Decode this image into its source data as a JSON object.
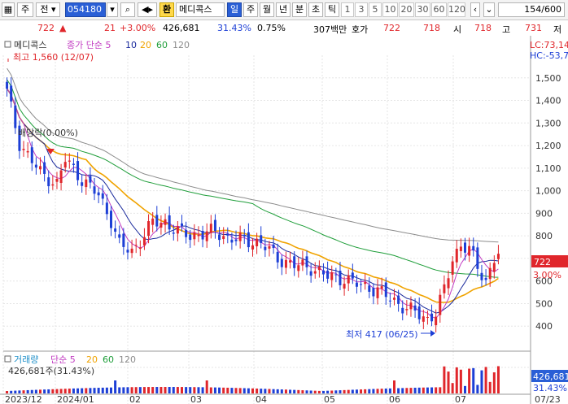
{
  "toolbar": {
    "type_label": "주",
    "period_label": "전",
    "stock_code": "054180",
    "exchange_label": "환",
    "stock_name": "메디콕스",
    "periods": [
      "일",
      "주",
      "월",
      "년",
      "분",
      "초",
      "틱"
    ],
    "selected_period": "일",
    "intervals": [
      "1",
      "3",
      "5",
      "10",
      "20",
      "30",
      "60",
      "120"
    ],
    "page_count": "154",
    "page_total": "/600"
  },
  "quote": {
    "price": "722",
    "change_arrow": "▲",
    "change": "21",
    "change_pct": "+3.00%",
    "volume": "426,681",
    "turnover_pct": "31.43%",
    "ratio": "0.75%",
    "amount": "307백만",
    "bid_label": "호가",
    "bid": "722",
    "ask": "718",
    "open_label": "시",
    "open": "718",
    "high_label": "고",
    "high": "731",
    "low_label": "저"
  },
  "chart": {
    "legend_name": "메디콕스",
    "legend_ma_label": "종가 단순 5",
    "legend_ma": [
      "10",
      "20",
      "60",
      "120"
    ],
    "high_note": "최고 1,560 (12/07)",
    "low_note": "최저 417 (06/25)",
    "dividend_note": "배당락(0.00%)",
    "lc_label": "LC:73,14",
    "hc_label": "HC:-53,7",
    "price_ticks": [
      "1,500",
      "1,400",
      "1,300",
      "1,200",
      "1,100",
      "1,000",
      "900",
      "800",
      "700",
      "600",
      "500",
      "400"
    ],
    "price_tag": "722",
    "pct_tag": "3.00%",
    "x_ticks": [
      "2023/12",
      "2024/01",
      "02",
      "03",
      "04",
      "05",
      "06",
      "07",
      "07/23"
    ],
    "volume_legend_name": "거래량",
    "volume_legend_ma": "단순 5",
    "volume_legend_values": [
      "20",
      "60",
      "120"
    ],
    "volume_value_note": "426,681주(31.43%)",
    "volume_tag": "426,681",
    "volume_pct_tag": "31.43%"
  },
  "colors": {
    "up": "#e0262b",
    "down": "#1d3fd6",
    "ma5": "#c23cc2",
    "ma10": "#1a2a9c",
    "ma20": "#f0a300",
    "ma60": "#1f9e3a",
    "ma120": "#8c8c8c"
  }
}
